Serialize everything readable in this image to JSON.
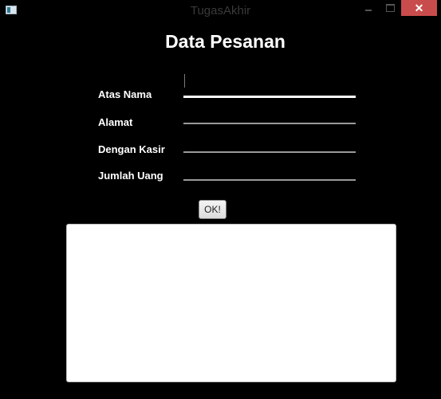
{
  "window": {
    "title": "TugasAkhir",
    "close_glyph": "✕"
  },
  "form": {
    "heading": "Data Pesanan",
    "fields": [
      {
        "label": "Atas Nama",
        "value": ""
      },
      {
        "label": "Alamat",
        "value": ""
      },
      {
        "label": "Dengan Kasir",
        "value": ""
      },
      {
        "label": "Jumlah Uang",
        "value": ""
      }
    ],
    "ok_label": "OK!",
    "output_text": ""
  },
  "icons": {
    "app": "window-app-icon",
    "minimize": "minimize-icon",
    "maximize": "maximize-icon",
    "close": "close-icon"
  }
}
